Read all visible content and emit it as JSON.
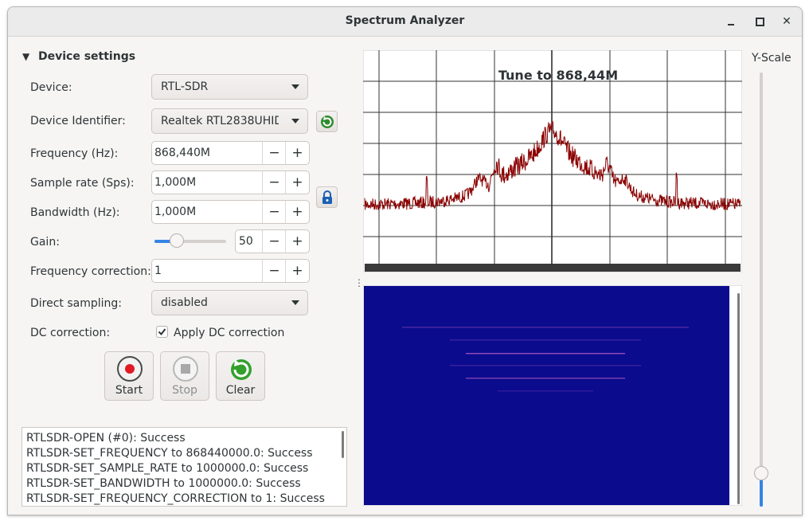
{
  "window": {
    "title": "Spectrum Analyzer"
  },
  "settings": {
    "expander_label": "Device settings",
    "device": {
      "label": "Device:",
      "value": "RTL-SDR"
    },
    "device_identifier": {
      "label": "Device Identifier:",
      "value": "Realtek RTL2838UHID"
    },
    "frequency": {
      "label": "Frequency (Hz):",
      "value": "868,440M"
    },
    "sample_rate": {
      "label": "Sample rate (Sps):",
      "value": "1,000M"
    },
    "bandwidth": {
      "label": "Bandwidth (Hz):",
      "value": "1,000M"
    },
    "gain": {
      "label": "Gain:",
      "value": "50",
      "slider_fraction": 0.27
    },
    "frequency_correction": {
      "label": "Frequency correction:",
      "value": "1"
    },
    "direct_sampling": {
      "label": "Direct sampling:",
      "value": "disabled"
    },
    "dc_correction": {
      "label": "DC correction:",
      "checkbox_label": "Apply DC correction",
      "checked": true
    }
  },
  "buttons": {
    "start": "Start",
    "stop": "Stop",
    "clear": "Clear"
  },
  "log": [
    "RTLSDR-OPEN (#0): Success",
    "RTLSDR-SET_FREQUENCY to 868440000.0: Success",
    "RTLSDR-SET_SAMPLE_RATE to 1000000.0: Success",
    "RTLSDR-SET_BANDWIDTH to 1000000.0: Success",
    "RTLSDR-SET_FREQUENCY_CORRECTION to 1: Success"
  ],
  "spectrum": {
    "title": "Tune to 868,44M"
  },
  "yscale": {
    "label": "Y-Scale",
    "slider_fraction": 0.04
  },
  "colors": {
    "trace": "#8b0000",
    "waterfall_bg": "#0b0b8e",
    "accent": "#3584e4"
  }
}
